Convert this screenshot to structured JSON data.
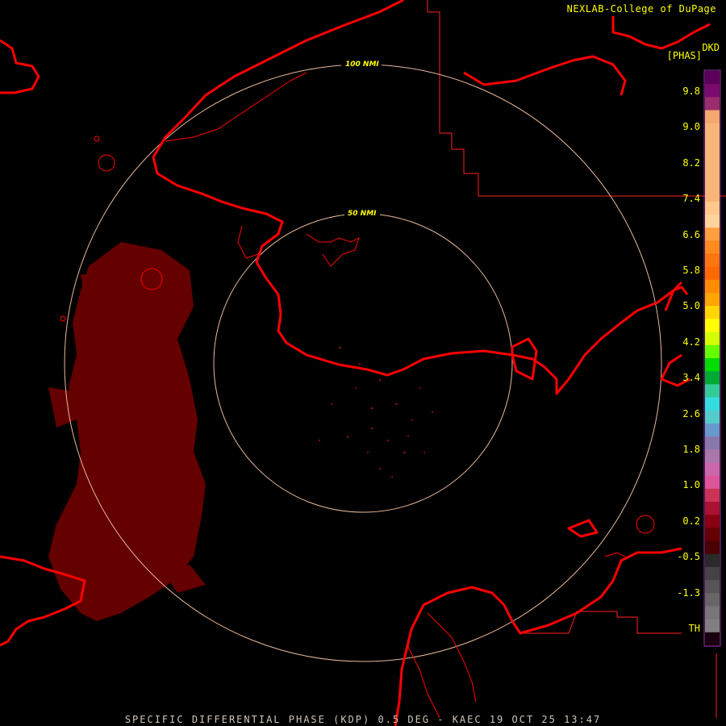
{
  "credit": "NEXLAB-College of DuPage",
  "product_code": "DKD",
  "units": "[PHAS]",
  "footer_title": "SPECIFIC DIFFERENTIAL PHASE (KDP) 0.5 DEG - KAEC 19 OCT 25 13:47",
  "range_rings": [
    {
      "label": "100 NMI"
    },
    {
      "label": "50 NMI"
    }
  ],
  "colorbar": {
    "ticks": [
      "9.8",
      "9.0",
      "8.2",
      "7.4",
      "6.6",
      "5.8",
      "5.0",
      "4.2",
      "3.4",
      "2.6",
      "1.8",
      "1.0",
      "0.2",
      "-0.5",
      "-1.3",
      "TH"
    ],
    "colors": [
      "#5b005b",
      "#7a0a6e",
      "#9a2d6d",
      "#f5a86e",
      "#f7b679",
      "#f7b679",
      "#f7b679",
      "#f7b679",
      "#f7b679",
      "#f7b679",
      "#ffc88c",
      "#ffd39b",
      "#ff9f40",
      "#ff8a20",
      "#ff7510",
      "#ff6a00",
      "#ff8c00",
      "#ffa500",
      "#ffd700",
      "#ffff00",
      "#d4ff00",
      "#66ff00",
      "#00dd00",
      "#00aa33",
      "#33cc99",
      "#33dddd",
      "#55cccc",
      "#6699cc",
      "#8877aa",
      "#aa77aa",
      "#cc66aa",
      "#dd5599",
      "#cc3355",
      "#aa1133",
      "#880011",
      "#660000",
      "#4a0000",
      "#2a2a2a",
      "#444444",
      "#555555",
      "#666666",
      "#777777",
      "#808080",
      "#1a0010"
    ]
  },
  "colors": {
    "coast": "#ff0000",
    "border": "#ff2020",
    "ring": "#e8b89a",
    "echo": "#6a0000",
    "text": "#ffff00"
  }
}
